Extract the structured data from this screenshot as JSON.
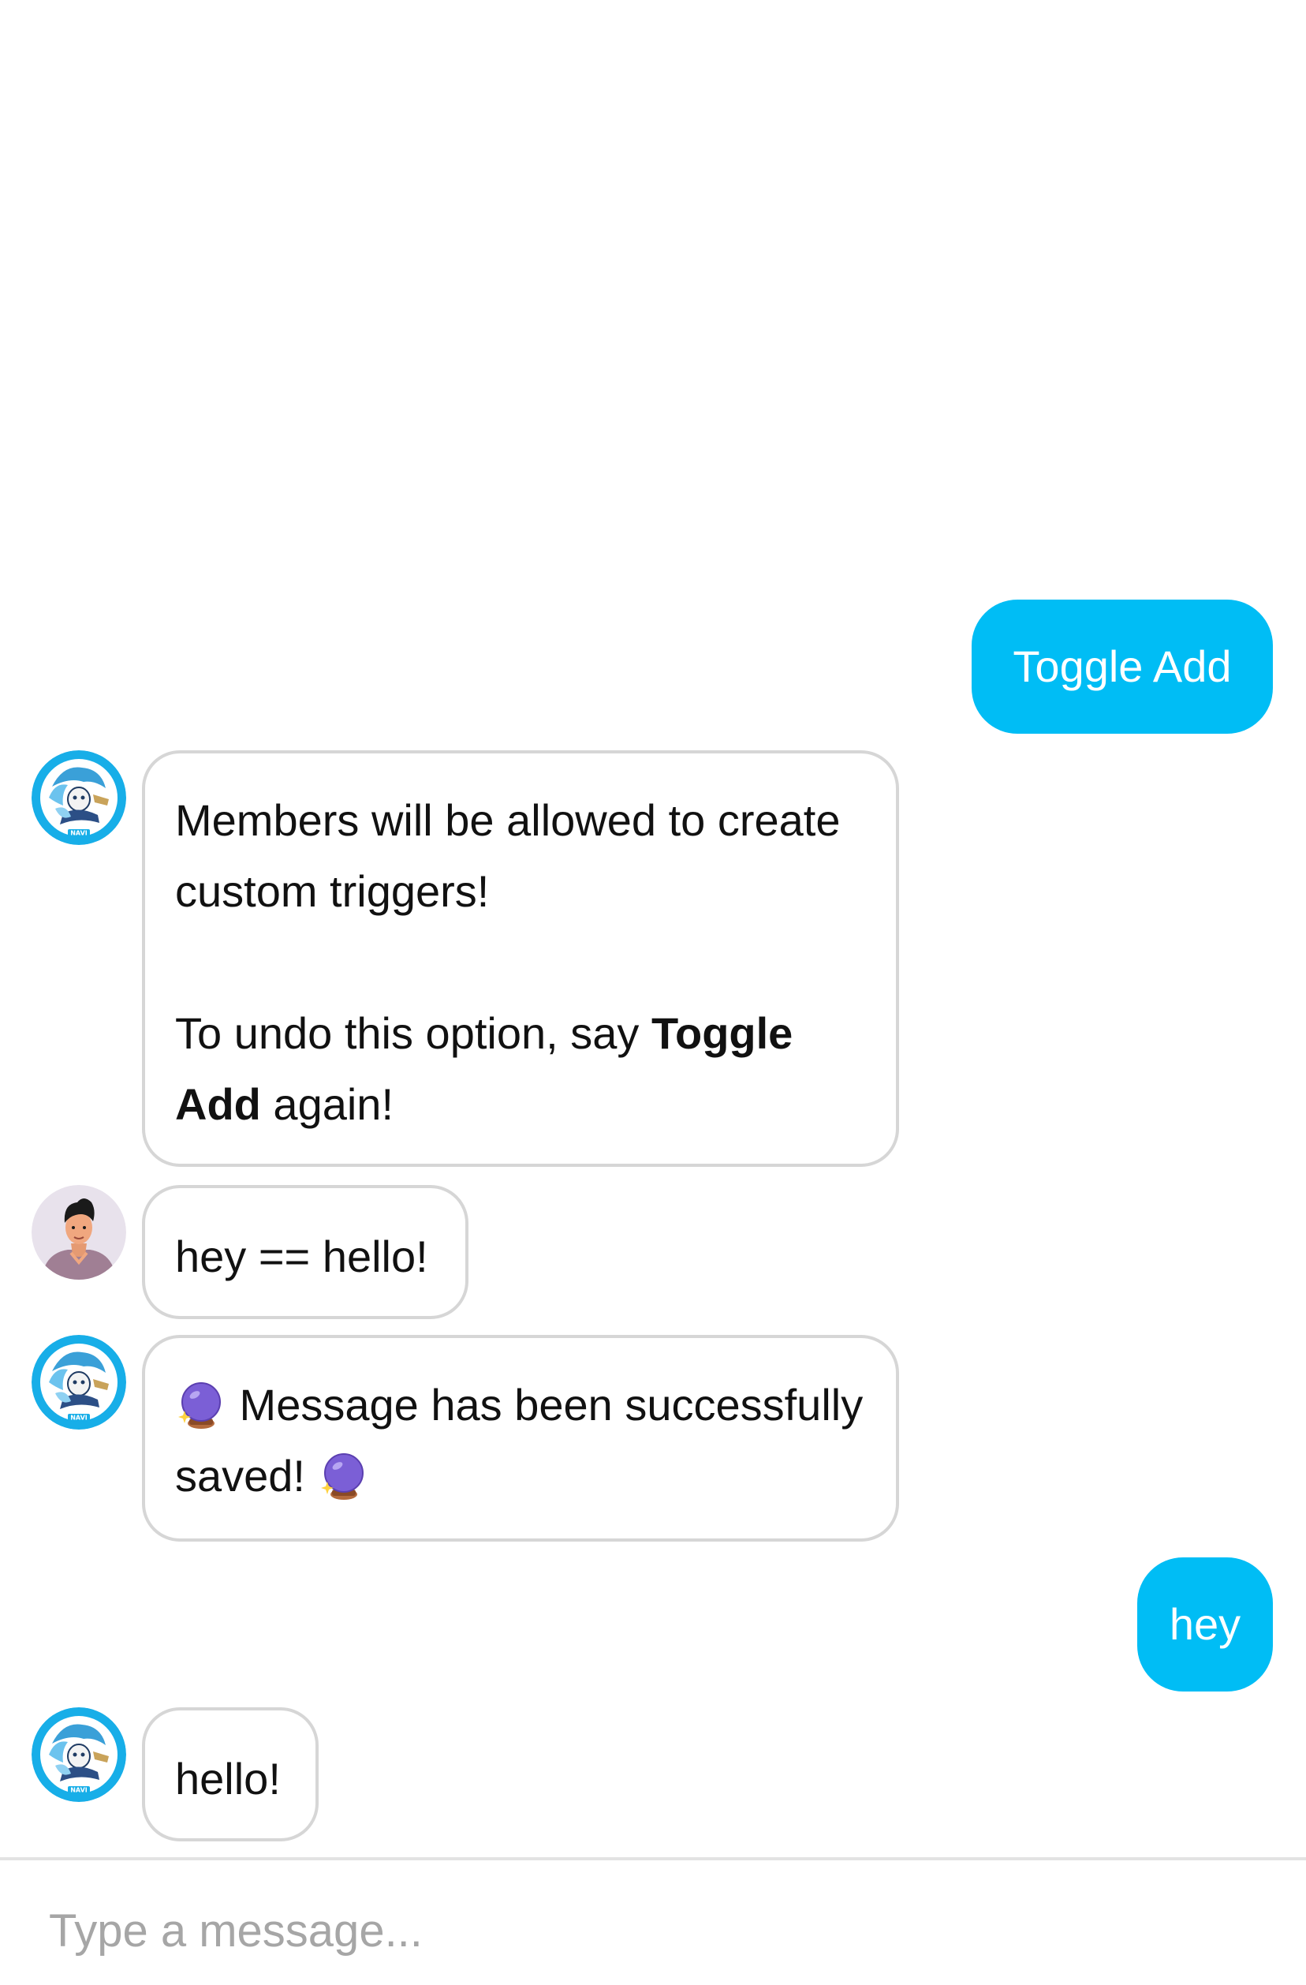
{
  "messages": [
    {
      "sender": "user",
      "text": "Toggle Add"
    },
    {
      "sender": "bot",
      "line1": "Members will be allowed to create custom triggers!",
      "line2_before": "To undo this option, say ",
      "line2_bold": "Toggle Add",
      "line2_after": " again!"
    },
    {
      "sender": "member",
      "text": "hey == hello!"
    },
    {
      "sender": "bot",
      "before": " Message has been successfully saved! ",
      "emoji": "crystal-ball"
    },
    {
      "sender": "user",
      "text": "hey"
    },
    {
      "sender": "bot",
      "text": "hello!"
    }
  ],
  "avatars": {
    "bot": {
      "badge": "NAVI",
      "ring_color": "#17aee8"
    },
    "member": {
      "background": "#e8e2ec",
      "shirt_color": "#a07f94",
      "skin_color": "#f0a77f"
    }
  },
  "composer": {
    "placeholder": "Type a message..."
  },
  "colors": {
    "outgoing_bubble": "#00bdf5",
    "incoming_border": "#d6d6d6"
  }
}
